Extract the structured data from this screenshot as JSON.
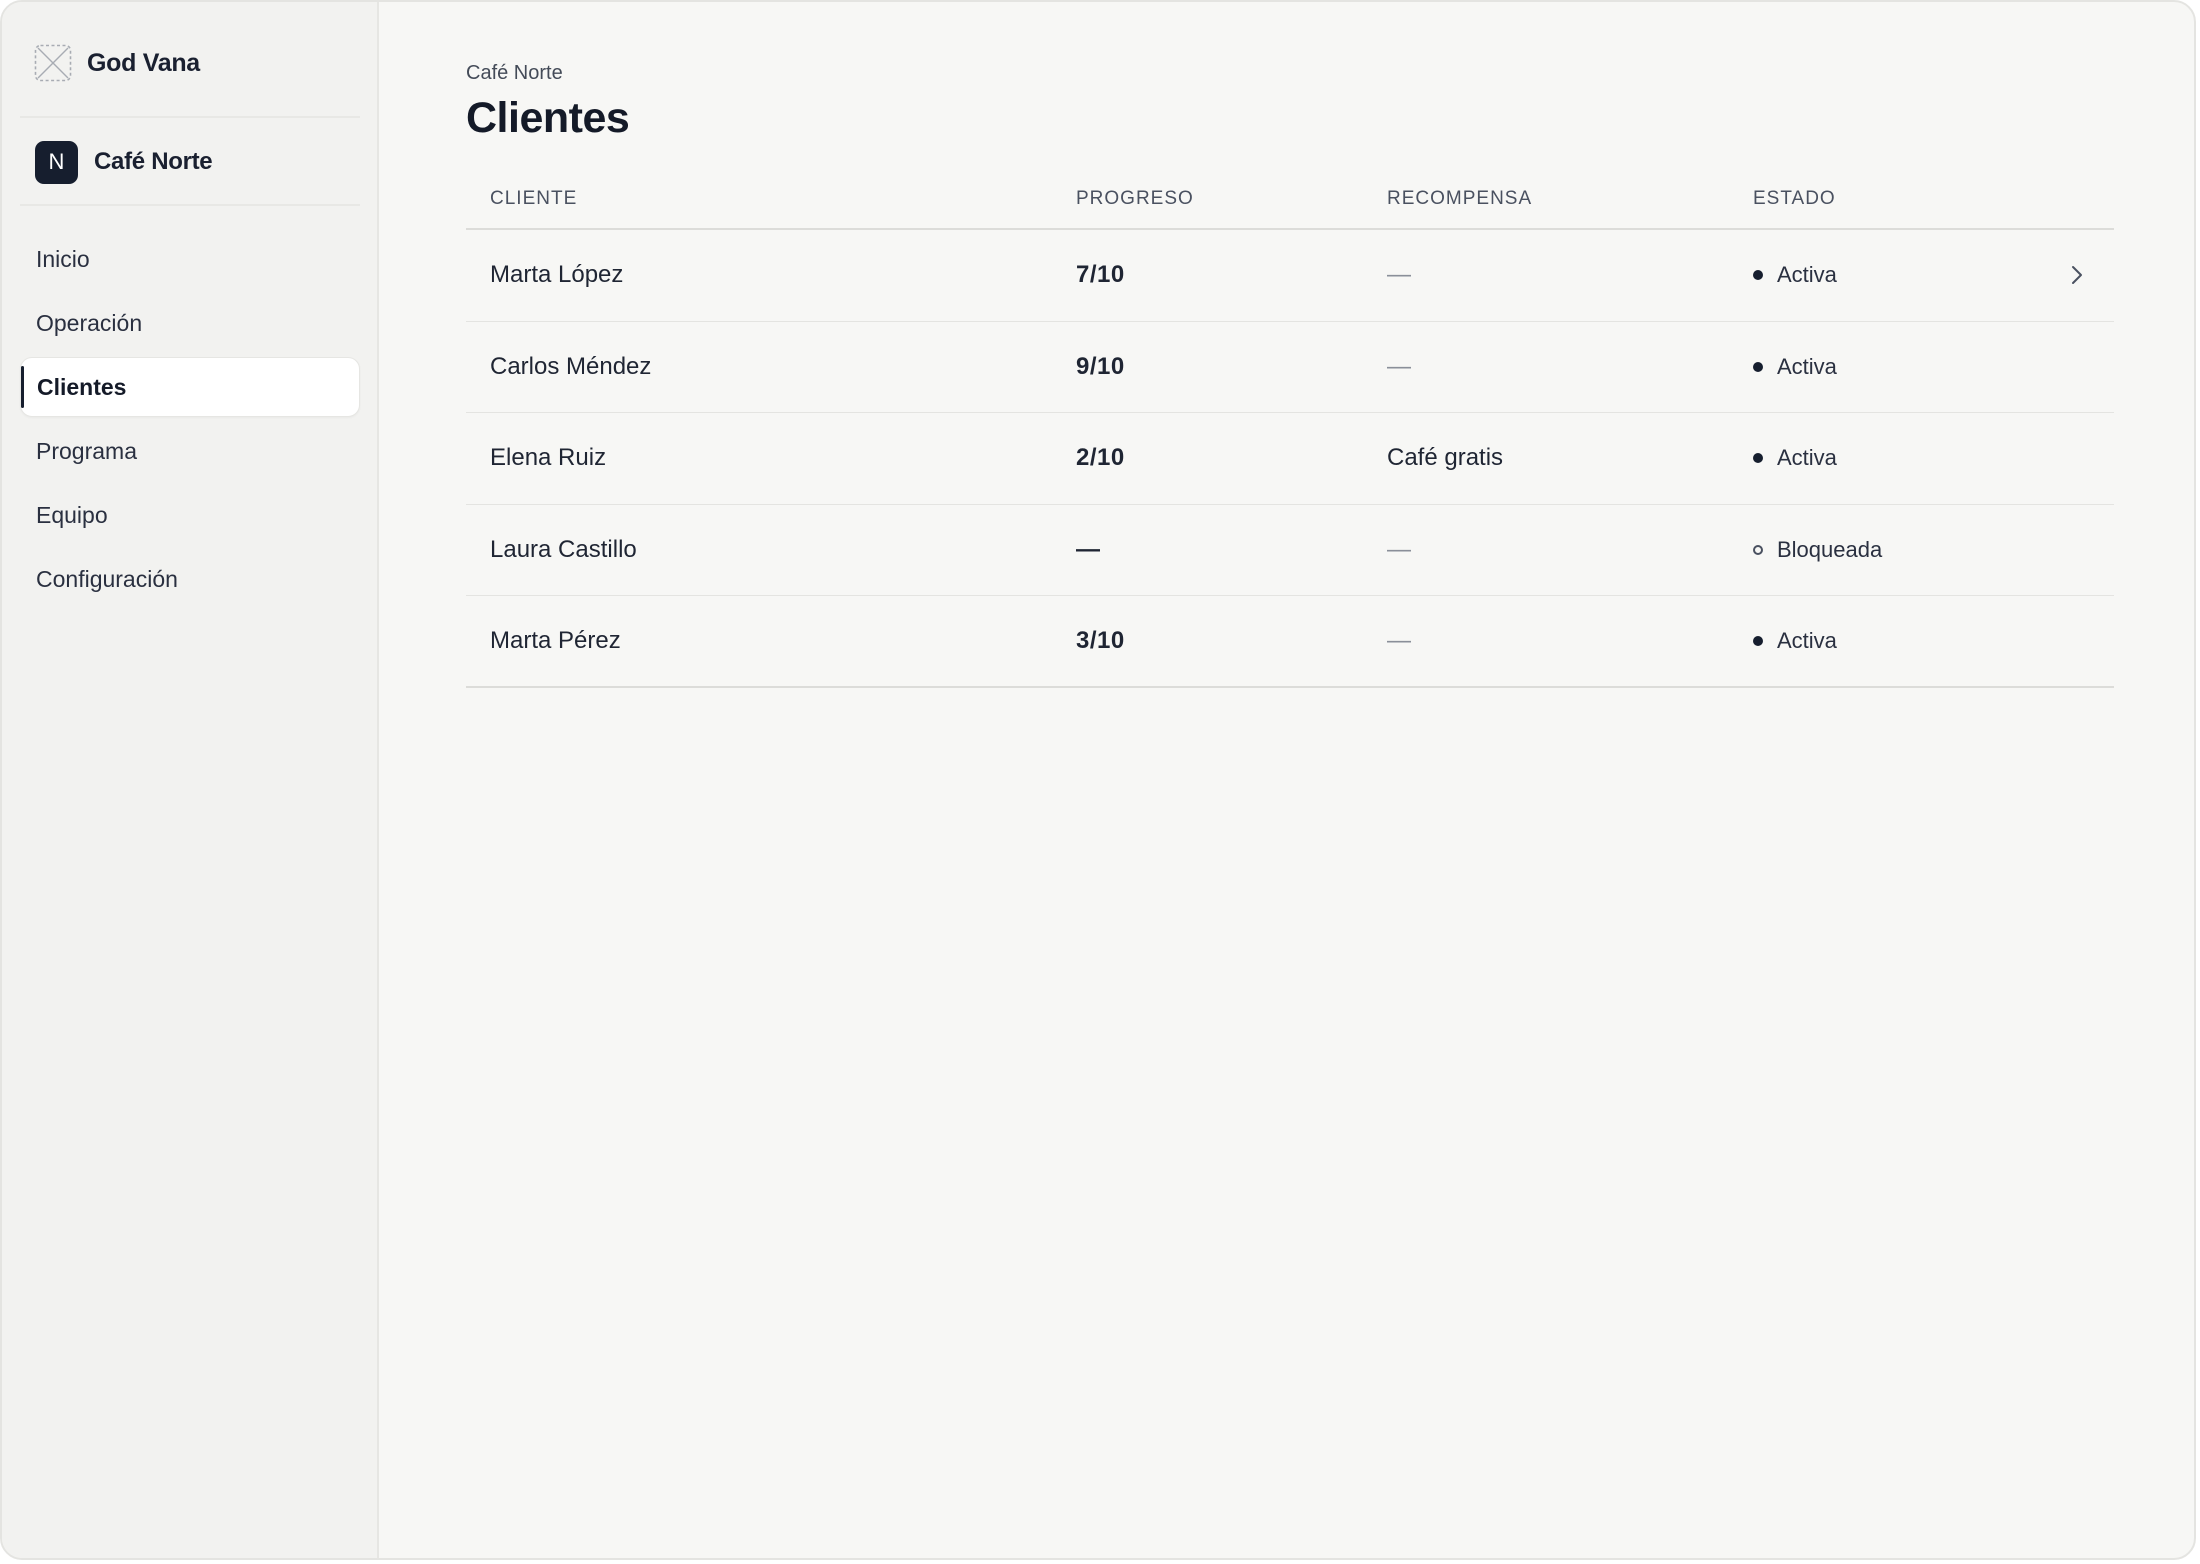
{
  "app": {
    "name": "God Vana",
    "logo_icon": "image-placeholder-icon"
  },
  "organization": {
    "initial": "N",
    "name": "Café Norte"
  },
  "sidebar": {
    "items": [
      {
        "label": "Inicio",
        "active": false
      },
      {
        "label": "Operación",
        "active": false
      },
      {
        "label": "Clientes",
        "active": true
      },
      {
        "label": "Programa",
        "active": false
      },
      {
        "label": "Equipo",
        "active": false
      },
      {
        "label": "Configuración",
        "active": false
      }
    ]
  },
  "header": {
    "breadcrumb": "Café Norte",
    "title": "Clientes"
  },
  "table": {
    "columns": [
      "CLIENTE",
      "PROGRESO",
      "RECOMPENSA",
      "ESTADO"
    ],
    "rows": [
      {
        "cliente": "Marta López",
        "progreso": "7/10",
        "recompensa": "—",
        "estado": "Activa",
        "estado_icon": "filled-dot",
        "chevron": true
      },
      {
        "cliente": "Carlos Méndez",
        "progreso": "9/10",
        "recompensa": "—",
        "estado": "Activa",
        "estado_icon": "filled-dot",
        "chevron": false
      },
      {
        "cliente": "Elena Ruiz",
        "progreso": "2/10",
        "recompensa": "Café gratis",
        "estado": "Activa",
        "estado_icon": "filled-dot",
        "chevron": false
      },
      {
        "cliente": "Laura Castillo",
        "progreso": "—",
        "recompensa": "—",
        "estado": "Bloqueada",
        "estado_icon": "hollow-dot",
        "chevron": false
      },
      {
        "cliente": "Marta Pérez",
        "progreso": "3/10",
        "recompensa": "—",
        "estado": "Activa",
        "estado_icon": "filled-dot",
        "chevron": false
      }
    ]
  },
  "colors": {
    "background": "#f7f7f5",
    "sidebar": "#f2f2f0",
    "accent": "#161e2e"
  }
}
